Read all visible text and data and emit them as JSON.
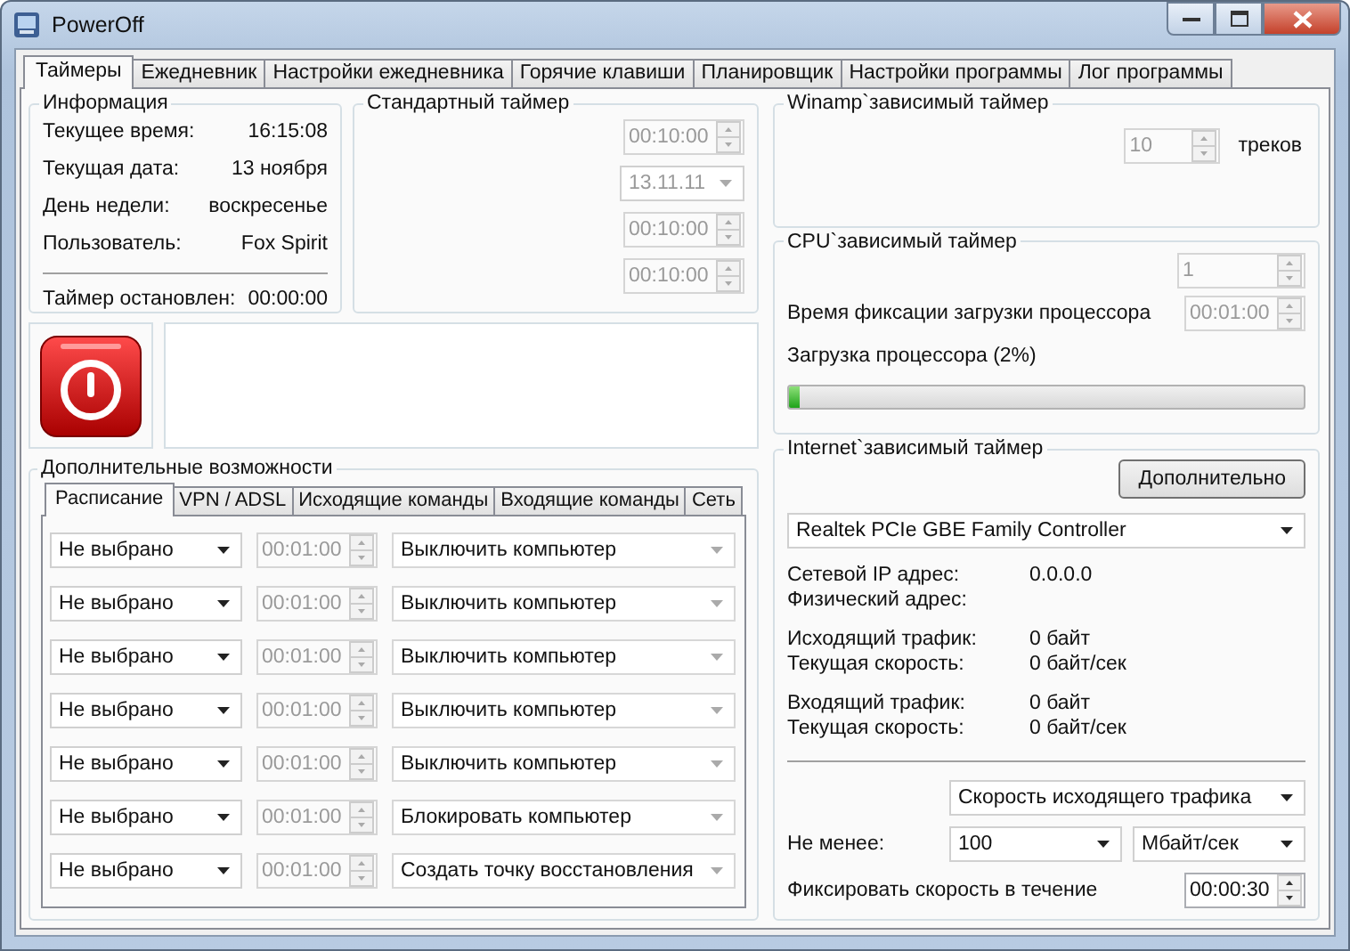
{
  "window": {
    "title": "PowerOff"
  },
  "tabs": [
    {
      "label": "Таймеры",
      "selected": true
    },
    {
      "label": "Ежедневник",
      "selected": false
    },
    {
      "label": "Настройки ежедневника",
      "selected": false
    },
    {
      "label": "Горячие клавиши",
      "selected": false
    },
    {
      "label": "Планировщик",
      "selected": false
    },
    {
      "label": "Настройки программы",
      "selected": false
    },
    {
      "label": "Лог программы",
      "selected": false
    }
  ],
  "info": {
    "title": "Информация",
    "rows": [
      {
        "label": "Текущее время:",
        "value": "16:15:08"
      },
      {
        "label": "Текущая дата:",
        "value": "13 ноября"
      },
      {
        "label": "День недели:",
        "value": "воскресенье"
      },
      {
        "label": "Пользователь:",
        "value": "Fox Spirit"
      }
    ],
    "timer": {
      "label": "Таймер остановлен:",
      "value": "00:00:00"
    }
  },
  "standard_timer": {
    "title": "Стандартный таймер",
    "fields": [
      {
        "kind": "spin",
        "value": "00:10:00",
        "disabled": true
      },
      {
        "kind": "date",
        "value": "13.11.11",
        "disabled": true
      },
      {
        "kind": "spin",
        "value": "00:10:00",
        "disabled": true
      },
      {
        "kind": "spin",
        "value": "00:10:00",
        "disabled": true
      }
    ]
  },
  "extra": {
    "title": "Дополнительные возможности",
    "tabs": [
      {
        "label": "Расписание",
        "selected": true
      },
      {
        "label": "VPN / ADSL",
        "selected": false
      },
      {
        "label": "Исходящие команды",
        "selected": false
      },
      {
        "label": "Входящие команды",
        "selected": false
      },
      {
        "label": "Сеть",
        "selected": false
      }
    ],
    "rows": [
      {
        "trigger": "Не выбрано",
        "time": "00:01:00",
        "time_disabled": true,
        "action": "Выключить компьютер",
        "action_disabled": true
      },
      {
        "trigger": "Не выбрано",
        "time": "00:01:00",
        "time_disabled": true,
        "action": "Выключить компьютер",
        "action_disabled": true
      },
      {
        "trigger": "Не выбрано",
        "time": "00:01:00",
        "time_disabled": true,
        "action": "Выключить компьютер",
        "action_disabled": true
      },
      {
        "trigger": "Не выбрано",
        "time": "00:01:00",
        "time_disabled": true,
        "action": "Выключить компьютер",
        "action_disabled": true
      },
      {
        "trigger": "Не выбрано",
        "time": "00:01:00",
        "time_disabled": true,
        "action": "Выключить компьютер",
        "action_disabled": true
      },
      {
        "trigger": "Не выбрано",
        "time": "00:01:00",
        "time_disabled": true,
        "action": "Блокировать компьютер",
        "action_disabled": true
      },
      {
        "trigger": "Не выбрано",
        "time": "00:01:00",
        "time_disabled": true,
        "action": "Создать точку восстановления",
        "action_disabled": true
      }
    ]
  },
  "winamp": {
    "title": "Winamp`зависимый таймер",
    "count": {
      "value": "10",
      "disabled": true
    },
    "unit": "треков"
  },
  "cpu": {
    "title": "CPU`зависимый таймер",
    "threshold": {
      "value": "1",
      "disabled": true
    },
    "fix_label": "Время фиксации загрузки процессора",
    "fix": {
      "value": "00:01:00",
      "disabled": true
    },
    "load_label": "Загрузка процессора (2%)",
    "level": 0.02
  },
  "internet": {
    "title": "Internet`зависимый таймер",
    "more_button": "Дополнительно",
    "adapter": "Realtek PCIe GBE Family Controller",
    "stats": [
      [
        {
          "label": "Сетевой IP адрес:",
          "value": "0.0.0.0"
        },
        {
          "label": "Физический адрес:"
        }
      ],
      [
        {
          "label": "Исходящий трафик:",
          "value": "0 байт"
        },
        {
          "label": "Текущая скорость:",
          "value": "0 байт/сек"
        }
      ],
      [
        {
          "label": "Входящий трафик:",
          "value": "0 байт"
        },
        {
          "label": "Текущая скорость:",
          "value": "0 байт/сек"
        }
      ]
    ],
    "mode": "Скорость исходящего трафика",
    "min_label": "Не менее:",
    "min_value": "100",
    "unit": "Мбайт/сек",
    "hold_label": "Фиксировать скорость в течение",
    "hold": {
      "value": "00:00:30",
      "disabled": false
    }
  }
}
